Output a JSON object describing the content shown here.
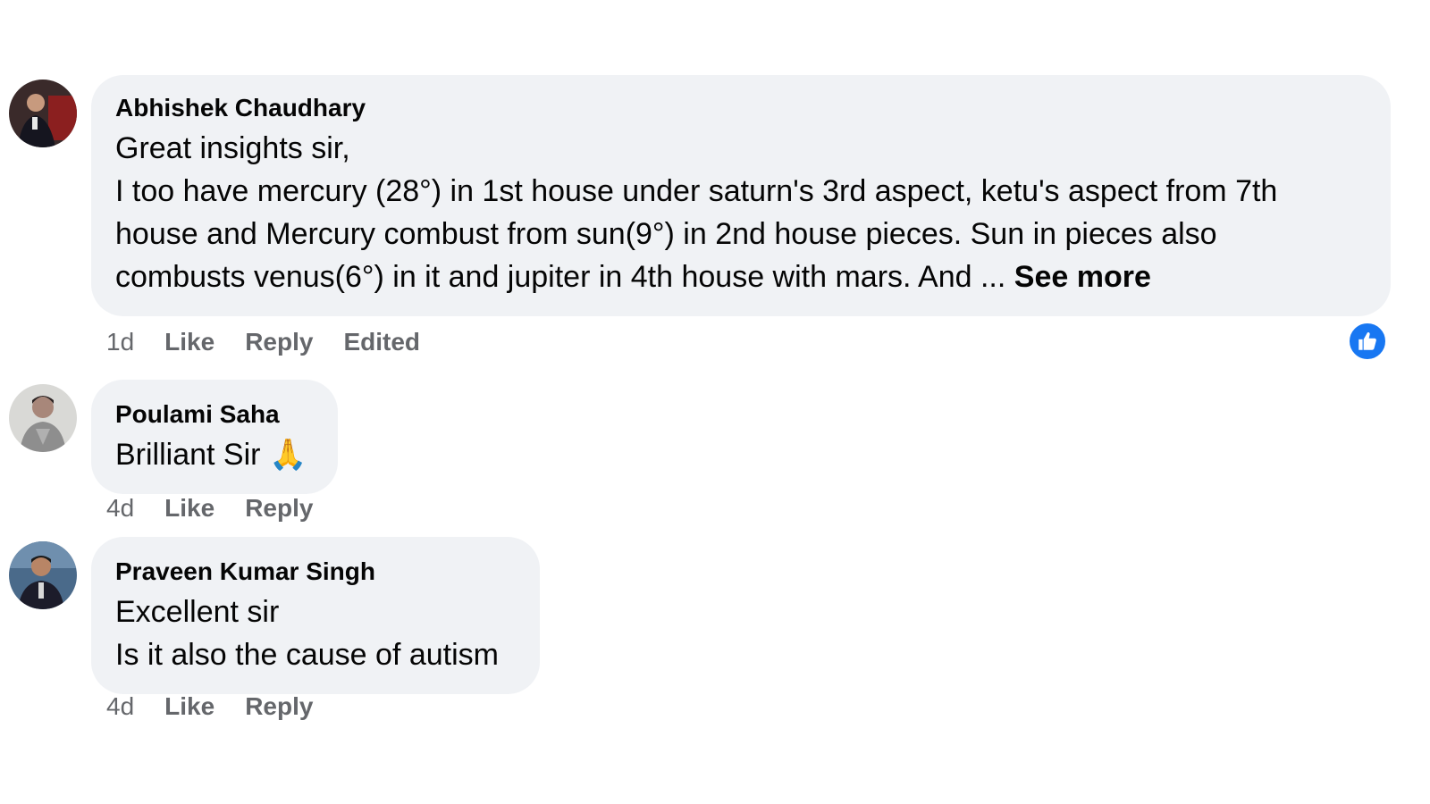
{
  "colors": {
    "bubble_bg": "#f0f2f5",
    "meta_text": "#65676b",
    "like_blue": "#1877f2"
  },
  "comments": [
    {
      "author": "Abhishek Chaudhary",
      "lines": [
        "Great insights sir,",
        "I too have mercury (28°) in 1st house under saturn's 3rd aspect, ketu's aspect from 7th",
        "house and Mercury combust from sun(9°) in 2nd house pieces. Sun in pieces also",
        "combusts venus(6°) in it and jupiter in 4th house with mars. And ... "
      ],
      "see_more": "See more",
      "time": "1d",
      "like": "Like",
      "reply": "Reply",
      "edited": "Edited",
      "avatar_icon": "profile-photo",
      "reaction_icon": "thumbs-up-icon"
    },
    {
      "author": "Poulami Saha",
      "lines": [
        "Brilliant Sir "
      ],
      "emoji": "🙏",
      "time": "4d",
      "like": "Like",
      "reply": "Reply",
      "avatar_icon": "profile-photo"
    },
    {
      "author": "Praveen Kumar Singh",
      "lines": [
        "Excellent sir",
        "Is it also the cause of autism"
      ],
      "time": "4d",
      "like": "Like",
      "reply": "Reply",
      "avatar_icon": "profile-photo"
    }
  ]
}
